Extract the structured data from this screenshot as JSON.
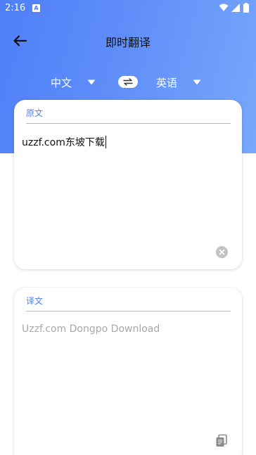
{
  "status_bar": {
    "time": "2:16",
    "notification_icon": "A",
    "icons": [
      "wifi-icon",
      "signal-icon",
      "battery-icon"
    ]
  },
  "header": {
    "title": "即时翻译",
    "back_icon": "arrow-left-icon"
  },
  "language_bar": {
    "source_language": "中文",
    "target_language": "英语",
    "swap_icon": "swap-icon",
    "caret_icon": "triangle-down-icon"
  },
  "source_card": {
    "label": "原文",
    "text": "uzzf.com东坡下载",
    "clear_icon": "clear-icon"
  },
  "result_card": {
    "label": "译文",
    "text": "Uzzf.com Dongpo Download",
    "copy_icon": "copy-icon"
  },
  "colors": {
    "accent": "#4f7ff8",
    "gradient_end": "#77a8fb",
    "placeholder_gray": "#a8a8a8"
  }
}
